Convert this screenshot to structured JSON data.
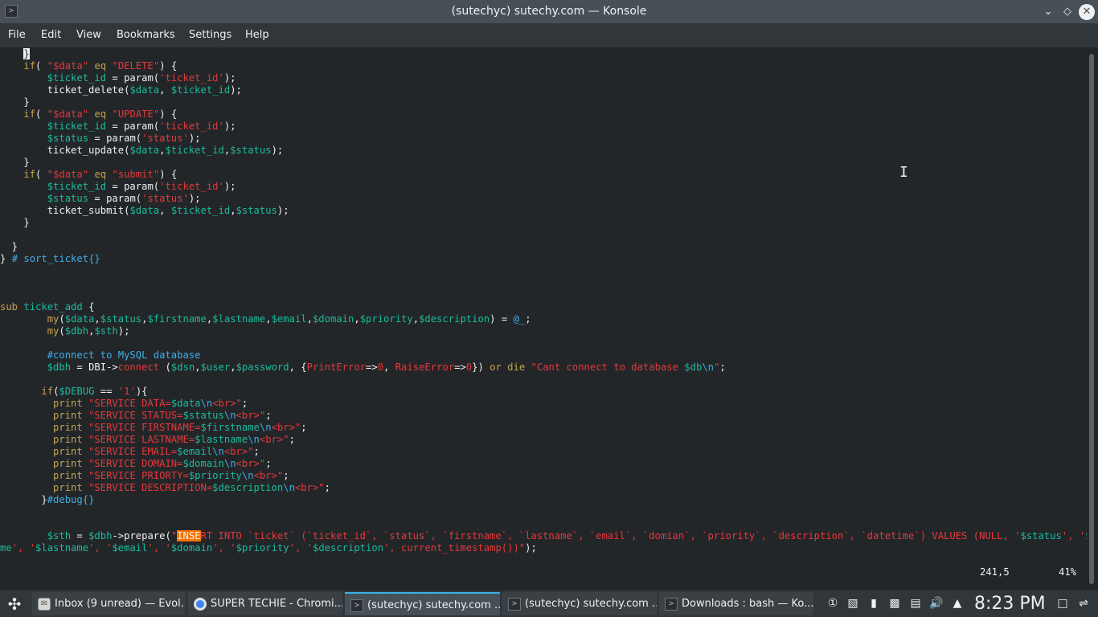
{
  "window": {
    "title": "(sutechyc) sutechy.com — Konsole"
  },
  "menu": [
    "File",
    "Edit",
    "View",
    "Bookmarks",
    "Settings",
    "Help"
  ],
  "status": {
    "position": "241,5",
    "percent": "41%"
  },
  "code_lines": [
    [
      [
        "    ",
        ""
      ],
      [
        "}",
        "cursor"
      ]
    ],
    [
      [
        "    ",
        ""
      ],
      [
        "if",
        "k"
      ],
      [
        "( ",
        ""
      ],
      [
        "\"$data\"",
        "s"
      ],
      [
        " ",
        ""
      ],
      [
        "eq",
        "k"
      ],
      [
        " ",
        ""
      ],
      [
        "\"DELETE\"",
        "s"
      ],
      [
        ") {",
        ""
      ]
    ],
    [
      [
        "        ",
        ""
      ],
      [
        "$ticket_id",
        "v"
      ],
      [
        " = param(",
        ""
      ],
      [
        "'ticket_id'",
        "s"
      ],
      [
        ");",
        ""
      ]
    ],
    [
      [
        "        ticket_delete(",
        ""
      ],
      [
        "$data",
        "v"
      ],
      [
        ", ",
        ""
      ],
      [
        "$ticket_id",
        "v"
      ],
      [
        ");",
        ""
      ]
    ],
    [
      [
        "    }",
        ""
      ]
    ],
    [
      [
        "    ",
        ""
      ],
      [
        "if",
        "k"
      ],
      [
        "( ",
        ""
      ],
      [
        "\"$data\"",
        "s"
      ],
      [
        " ",
        ""
      ],
      [
        "eq",
        "k"
      ],
      [
        " ",
        ""
      ],
      [
        "\"UPDATE\"",
        "s"
      ],
      [
        ") {",
        ""
      ]
    ],
    [
      [
        "        ",
        ""
      ],
      [
        "$ticket_id",
        "v"
      ],
      [
        " = param(",
        ""
      ],
      [
        "'ticket_id'",
        "s"
      ],
      [
        ");",
        ""
      ]
    ],
    [
      [
        "        ",
        ""
      ],
      [
        "$status",
        "v"
      ],
      [
        " = param(",
        ""
      ],
      [
        "'status'",
        "s"
      ],
      [
        ");",
        ""
      ]
    ],
    [
      [
        "        ticket_update(",
        ""
      ],
      [
        "$data",
        "v"
      ],
      [
        ",",
        ""
      ],
      [
        "$ticket_id",
        "v"
      ],
      [
        ",",
        ""
      ],
      [
        "$status",
        "v"
      ],
      [
        ");",
        ""
      ]
    ],
    [
      [
        "    }",
        ""
      ]
    ],
    [
      [
        "    ",
        ""
      ],
      [
        "if",
        "k"
      ],
      [
        "( ",
        ""
      ],
      [
        "\"$data\"",
        "s"
      ],
      [
        " ",
        ""
      ],
      [
        "eq",
        "k"
      ],
      [
        " ",
        ""
      ],
      [
        "\"submit\"",
        "s"
      ],
      [
        ") {",
        ""
      ]
    ],
    [
      [
        "        ",
        ""
      ],
      [
        "$ticket_id",
        "v"
      ],
      [
        " = param(",
        ""
      ],
      [
        "'ticket_id'",
        "s"
      ],
      [
        ");",
        ""
      ]
    ],
    [
      [
        "        ",
        ""
      ],
      [
        "$status",
        "v"
      ],
      [
        " = param(",
        ""
      ],
      [
        "'status'",
        "s"
      ],
      [
        ");",
        ""
      ]
    ],
    [
      [
        "        ticket_submit(",
        ""
      ],
      [
        "$data",
        "v"
      ],
      [
        ", ",
        ""
      ],
      [
        "$ticket_id",
        "v"
      ],
      [
        ",",
        ""
      ],
      [
        "$status",
        "v"
      ],
      [
        ");",
        ""
      ]
    ],
    [
      [
        "    }",
        ""
      ]
    ],
    [
      [
        "",
        ""
      ]
    ],
    [
      [
        "  }",
        ""
      ]
    ],
    [
      [
        "} ",
        ""
      ],
      [
        "# sort_ticket{}",
        "c"
      ]
    ],
    [
      [
        "",
        ""
      ]
    ],
    [
      [
        "",
        ""
      ]
    ],
    [
      [
        "",
        ""
      ]
    ],
    [
      [
        "sub",
        "k"
      ],
      [
        " ",
        ""
      ],
      [
        "ticket_add",
        "v"
      ],
      [
        " {",
        ""
      ]
    ],
    [
      [
        "        ",
        ""
      ],
      [
        "my",
        "k"
      ],
      [
        "(",
        ""
      ],
      [
        "$data",
        "v"
      ],
      [
        ",",
        ""
      ],
      [
        "$status",
        "v"
      ],
      [
        ",",
        ""
      ],
      [
        "$firstname",
        "v"
      ],
      [
        ",",
        ""
      ],
      [
        "$lastname",
        "v"
      ],
      [
        ",",
        ""
      ],
      [
        "$email",
        "v"
      ],
      [
        ",",
        ""
      ],
      [
        "$domain",
        "v"
      ],
      [
        ",",
        ""
      ],
      [
        "$priority",
        "v"
      ],
      [
        ",",
        ""
      ],
      [
        "$description",
        "v"
      ],
      [
        ") = ",
        ""
      ],
      [
        "@_",
        "c"
      ],
      [
        ";",
        ""
      ]
    ],
    [
      [
        "        ",
        ""
      ],
      [
        "my",
        "k"
      ],
      [
        "(",
        ""
      ],
      [
        "$dbh",
        "v"
      ],
      [
        ",",
        ""
      ],
      [
        "$sth",
        "v"
      ],
      [
        ");",
        ""
      ]
    ],
    [
      [
        "",
        ""
      ]
    ],
    [
      [
        "        ",
        ""
      ],
      [
        "#connect to MySQL database",
        "c"
      ]
    ],
    [
      [
        "        ",
        ""
      ],
      [
        "$dbh",
        "v"
      ],
      [
        " = DBI->",
        ""
      ],
      [
        "connect",
        "s"
      ],
      [
        " (",
        ""
      ],
      [
        "$dsn",
        "v"
      ],
      [
        ",",
        ""
      ],
      [
        "$user",
        "v"
      ],
      [
        ",",
        ""
      ],
      [
        "$password",
        "v"
      ],
      [
        ", {",
        ""
      ],
      [
        "PrintError",
        "s"
      ],
      [
        "=>",
        ""
      ],
      [
        "0",
        "s"
      ],
      [
        ", ",
        ""
      ],
      [
        "RaiseError",
        "s"
      ],
      [
        "=>",
        ""
      ],
      [
        "0",
        "s"
      ],
      [
        "}) ",
        ""
      ],
      [
        "or die",
        "k"
      ],
      [
        " ",
        ""
      ],
      [
        "\"Cant connect to database ",
        "s"
      ],
      [
        "$db",
        "v"
      ],
      [
        "\\n",
        "c"
      ],
      [
        "\"",
        "s"
      ],
      [
        ";",
        ""
      ]
    ],
    [
      [
        "",
        ""
      ]
    ],
    [
      [
        "       ",
        ""
      ],
      [
        "if",
        "k"
      ],
      [
        "(",
        ""
      ],
      [
        "$DEBUG",
        "v"
      ],
      [
        " == ",
        ""
      ],
      [
        "'1'",
        "s"
      ],
      [
        "){",
        ""
      ]
    ],
    [
      [
        "         ",
        ""
      ],
      [
        "print",
        "k"
      ],
      [
        " ",
        ""
      ],
      [
        "\"SERVICE DATA=",
        "s"
      ],
      [
        "$data",
        "v"
      ],
      [
        "\\n",
        "c"
      ],
      [
        "<br>\"",
        "s"
      ],
      [
        ";",
        ""
      ]
    ],
    [
      [
        "         ",
        ""
      ],
      [
        "print",
        "k"
      ],
      [
        " ",
        ""
      ],
      [
        "\"SERVICE STATUS=",
        "s"
      ],
      [
        "$status",
        "v"
      ],
      [
        "\\n",
        "c"
      ],
      [
        "<br>\"",
        "s"
      ],
      [
        ";",
        ""
      ]
    ],
    [
      [
        "         ",
        ""
      ],
      [
        "print",
        "k"
      ],
      [
        " ",
        ""
      ],
      [
        "\"SERVICE FIRSTNAME=",
        "s"
      ],
      [
        "$firstname",
        "v"
      ],
      [
        "\\n",
        "c"
      ],
      [
        "<br>\"",
        "s"
      ],
      [
        ";",
        ""
      ]
    ],
    [
      [
        "         ",
        ""
      ],
      [
        "print",
        "k"
      ],
      [
        " ",
        ""
      ],
      [
        "\"SERVICE LASTNAME=",
        "s"
      ],
      [
        "$lastname",
        "v"
      ],
      [
        "\\n",
        "c"
      ],
      [
        "<br>\"",
        "s"
      ],
      [
        ";",
        ""
      ]
    ],
    [
      [
        "         ",
        ""
      ],
      [
        "print",
        "k"
      ],
      [
        " ",
        ""
      ],
      [
        "\"SERVICE EMAIL=",
        "s"
      ],
      [
        "$email",
        "v"
      ],
      [
        "\\n",
        "c"
      ],
      [
        "<br>\"",
        "s"
      ],
      [
        ";",
        ""
      ]
    ],
    [
      [
        "         ",
        ""
      ],
      [
        "print",
        "k"
      ],
      [
        " ",
        ""
      ],
      [
        "\"SERVICE DOMAIN=",
        "s"
      ],
      [
        "$domain",
        "v"
      ],
      [
        "\\n",
        "c"
      ],
      [
        "<br>\"",
        "s"
      ],
      [
        ";",
        ""
      ]
    ],
    [
      [
        "         ",
        ""
      ],
      [
        "print",
        "k"
      ],
      [
        " ",
        ""
      ],
      [
        "\"SERVICE PRIORTY=",
        "s"
      ],
      [
        "$priority",
        "v"
      ],
      [
        "\\n",
        "c"
      ],
      [
        "<br>\"",
        "s"
      ],
      [
        ";",
        ""
      ]
    ],
    [
      [
        "         ",
        ""
      ],
      [
        "print",
        "k"
      ],
      [
        " ",
        ""
      ],
      [
        "\"SERVICE DESCRIPTION=",
        "s"
      ],
      [
        "$description",
        "v"
      ],
      [
        "\\n",
        "c"
      ],
      [
        "<br>\"",
        "s"
      ],
      [
        ";",
        ""
      ]
    ],
    [
      [
        "       }",
        ""
      ],
      [
        "#debug{}",
        "c"
      ]
    ],
    [
      [
        "",
        ""
      ]
    ],
    [
      [
        "",
        ""
      ]
    ],
    [
      [
        "        ",
        ""
      ],
      [
        "$sth",
        "v"
      ],
      [
        " = ",
        ""
      ],
      [
        "$dbh",
        "v"
      ],
      [
        "->prepare(",
        ""
      ],
      [
        "\"",
        "s"
      ],
      [
        "INSE",
        "hl"
      ],
      [
        "RT INTO `ticket` (`ticket_id`, `status`, `firstname`, `lastname`, `email`, `domian`, `priority`, `description`, `datetime`) VALUES (NULL, '",
        "s"
      ],
      [
        "$status",
        "v"
      ],
      [
        "', '",
        "s"
      ],
      [
        "$firstna",
        "v"
      ]
    ],
    [
      [
        "me",
        "v"
      ],
      [
        "', '",
        "s"
      ],
      [
        "$lastname",
        "v"
      ],
      [
        "', '",
        "s"
      ],
      [
        "$email",
        "v"
      ],
      [
        "', '",
        "s"
      ],
      [
        "$domain",
        "v"
      ],
      [
        "', '",
        "s"
      ],
      [
        "$priority",
        "v"
      ],
      [
        "', '",
        "s"
      ],
      [
        "$description",
        "v"
      ],
      [
        "', current_timestamp())\"",
        "s"
      ],
      [
        ");",
        ""
      ]
    ]
  ],
  "taskbar": {
    "tasks": [
      {
        "label": "Inbox (9 unread) — Evol...",
        "icon": "mail-icon"
      },
      {
        "label": "SUPER TECHIE - Chromi...",
        "icon": "chrome-icon"
      },
      {
        "label": "(sutechyc) sutechy.com ...",
        "icon": "terminal-icon"
      },
      {
        "label": "(sutechyc) sutechy.com ...",
        "icon": "terminal-icon"
      },
      {
        "label": "Downloads : bash — Ko...",
        "icon": "terminal-icon"
      }
    ],
    "clock": "8:23 PM"
  }
}
